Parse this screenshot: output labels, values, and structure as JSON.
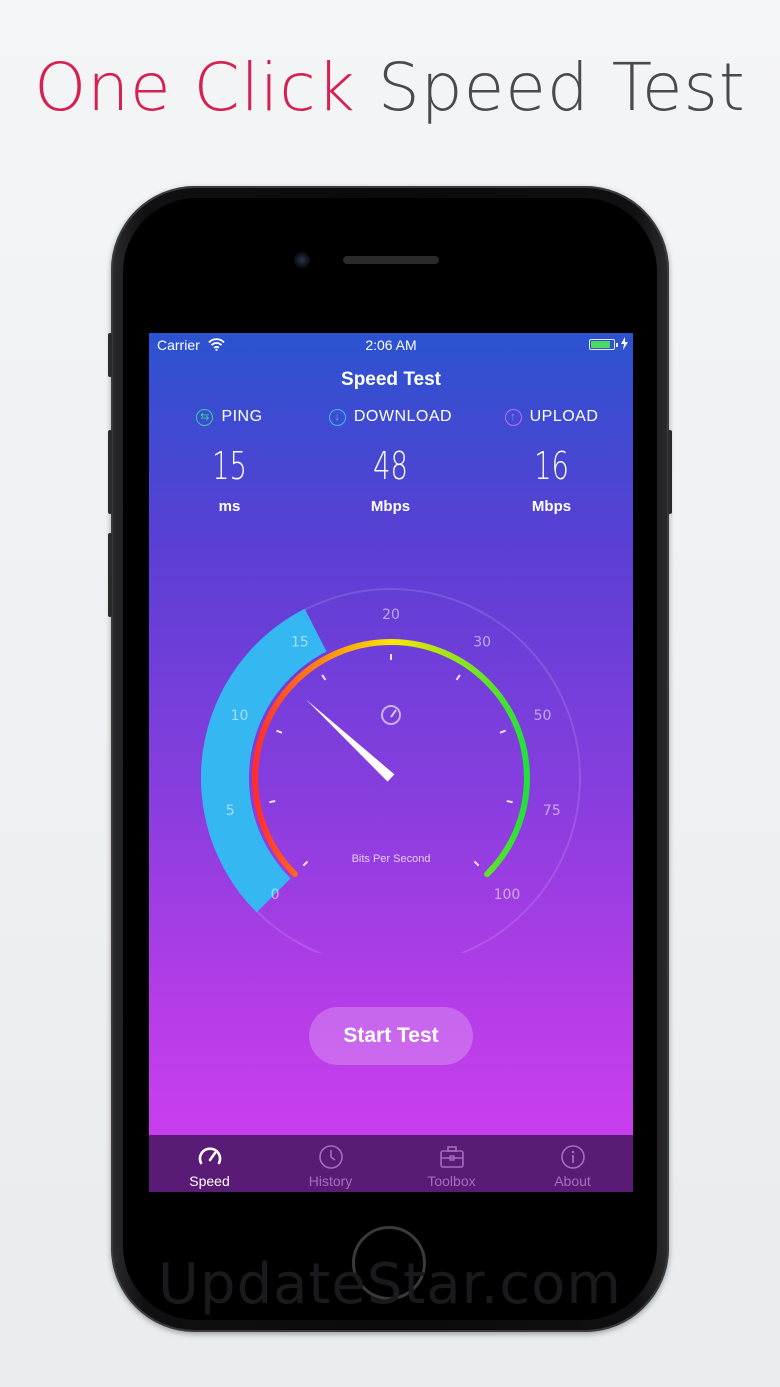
{
  "headline": {
    "part1": "One Click",
    "part2": "Speed Test"
  },
  "watermark": "UpdateStar.com",
  "status": {
    "carrier": "Carrier",
    "time": "2:06 AM",
    "battery_level": 0.85
  },
  "nav": {
    "title": "Speed Test"
  },
  "metrics": [
    {
      "name": "PING",
      "value": "15",
      "unit": "ms",
      "icon": "ping-arrows-icon",
      "color": "#2fd39a"
    },
    {
      "name": "DOWNLOAD",
      "value": "48",
      "unit": "Mbps",
      "icon": "download-arrow-icon",
      "color": "#35c2f0"
    },
    {
      "name": "UPLOAD",
      "value": "16",
      "unit": "Mbps",
      "icon": "upload-arrow-icon",
      "color": "#c66cff"
    }
  ],
  "gauge": {
    "label": "Bits Per Second",
    "ticks": [
      "0",
      "5",
      "10",
      "15",
      "20",
      "30",
      "50",
      "75",
      "100"
    ],
    "needle_tick_position": 2.6,
    "fill_tick_position": 3.2,
    "icon": "speedometer-icon",
    "colors": {
      "fill": "#35b7f2",
      "arc_start": "#ff2d2d",
      "arc_mid": "#ffe600",
      "arc_end": "#22e03c"
    }
  },
  "start_button": {
    "label": "Start Test"
  },
  "tabs": [
    {
      "label": "Speed",
      "icon": "speedometer-icon",
      "active": true
    },
    {
      "label": "History",
      "icon": "clock-icon",
      "active": false
    },
    {
      "label": "Toolbox",
      "icon": "toolbox-icon",
      "active": false
    },
    {
      "label": "About",
      "icon": "info-icon",
      "active": false
    }
  ]
}
